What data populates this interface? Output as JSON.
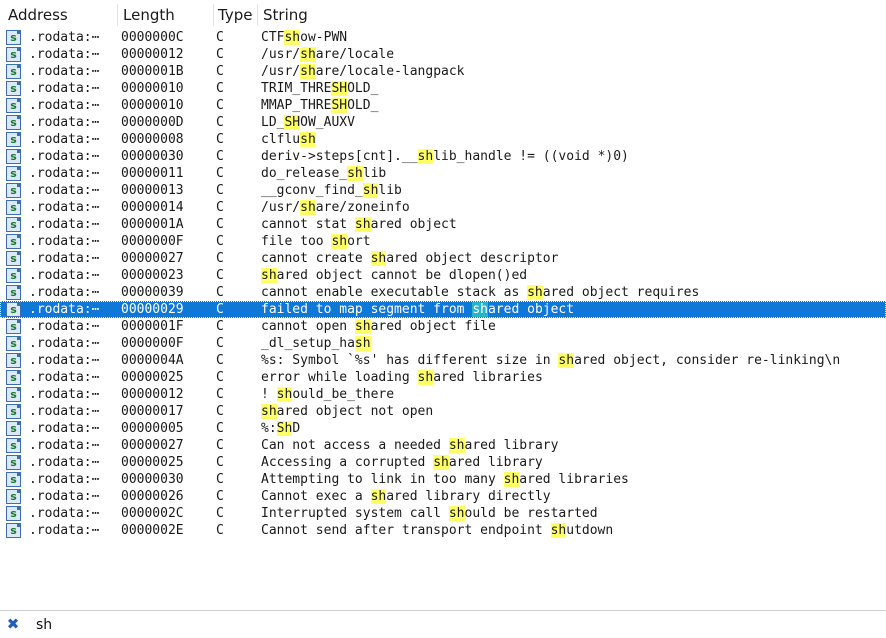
{
  "columns": {
    "address": "Address",
    "length": "Length",
    "type": "Type",
    "string": "String"
  },
  "highlight_color": "#ffff66",
  "selection_color": "#0f78d7",
  "row_icon": "string-s-icon",
  "selected_index": 16,
  "rows": [
    {
      "address": ".rodata:⋯",
      "length": "0000000C",
      "type": "C",
      "string": "CTFshow-PWN"
    },
    {
      "address": ".rodata:⋯",
      "length": "00000012",
      "type": "C",
      "string": "/usr/share/locale"
    },
    {
      "address": ".rodata:⋯",
      "length": "0000001B",
      "type": "C",
      "string": "/usr/share/locale-langpack"
    },
    {
      "address": ".rodata:⋯",
      "length": "00000010",
      "type": "C",
      "string": "TRIM_THRESHOLD_"
    },
    {
      "address": ".rodata:⋯",
      "length": "00000010",
      "type": "C",
      "string": "MMAP_THRESHOLD_"
    },
    {
      "address": ".rodata:⋯",
      "length": "0000000D",
      "type": "C",
      "string": "LD_SHOW_AUXV"
    },
    {
      "address": ".rodata:⋯",
      "length": "00000008",
      "type": "C",
      "string": "clflush"
    },
    {
      "address": ".rodata:⋯",
      "length": "00000030",
      "type": "C",
      "string": "deriv->steps[cnt].__shlib_handle != ((void *)0)"
    },
    {
      "address": ".rodata:⋯",
      "length": "00000011",
      "type": "C",
      "string": "do_release_shlib"
    },
    {
      "address": ".rodata:⋯",
      "length": "00000013",
      "type": "C",
      "string": "__gconv_find_shlib"
    },
    {
      "address": ".rodata:⋯",
      "length": "00000014",
      "type": "C",
      "string": "/usr/share/zoneinfo"
    },
    {
      "address": ".rodata:⋯",
      "length": "0000001A",
      "type": "C",
      "string": "cannot stat shared object"
    },
    {
      "address": ".rodata:⋯",
      "length": "0000000F",
      "type": "C",
      "string": "file too short"
    },
    {
      "address": ".rodata:⋯",
      "length": "00000027",
      "type": "C",
      "string": "cannot create shared object descriptor"
    },
    {
      "address": ".rodata:⋯",
      "length": "00000023",
      "type": "C",
      "string": "shared object cannot be dlopen()ed"
    },
    {
      "address": ".rodata:⋯",
      "length": "00000039",
      "type": "C",
      "string": "cannot enable executable stack as shared object requires"
    },
    {
      "address": ".rodata:⋯",
      "length": "00000029",
      "type": "C",
      "string": "failed to map segment from shared object"
    },
    {
      "address": ".rodata:⋯",
      "length": "0000001F",
      "type": "C",
      "string": "cannot open shared object file"
    },
    {
      "address": ".rodata:⋯",
      "length": "0000000F",
      "type": "C",
      "string": "_dl_setup_hash"
    },
    {
      "address": ".rodata:⋯",
      "length": "0000004A",
      "type": "C",
      "string": "%s: Symbol `%s' has different size in shared object, consider re-linking\\n"
    },
    {
      "address": ".rodata:⋯",
      "length": "00000025",
      "type": "C",
      "string": "error while loading shared libraries"
    },
    {
      "address": ".rodata:⋯",
      "length": "00000012",
      "type": "C",
      "string": "! should_be_there"
    },
    {
      "address": ".rodata:⋯",
      "length": "00000017",
      "type": "C",
      "string": "shared object not open"
    },
    {
      "address": ".rodata:⋯",
      "length": "00000005",
      "type": "C",
      "string": "%:ShD"
    },
    {
      "address": ".rodata:⋯",
      "length": "00000027",
      "type": "C",
      "string": "Can not access a needed shared library"
    },
    {
      "address": ".rodata:⋯",
      "length": "00000025",
      "type": "C",
      "string": "Accessing a corrupted shared library"
    },
    {
      "address": ".rodata:⋯",
      "length": "00000030",
      "type": "C",
      "string": "Attempting to link in too many shared libraries"
    },
    {
      "address": ".rodata:⋯",
      "length": "00000026",
      "type": "C",
      "string": "Cannot exec a shared library directly"
    },
    {
      "address": ".rodata:⋯",
      "length": "0000002C",
      "type": "C",
      "string": "Interrupted system call should be restarted"
    },
    {
      "address": ".rodata:⋯",
      "length": "0000002E",
      "type": "C",
      "string": "Cannot send after transport endpoint shutdown"
    }
  ],
  "search": {
    "icon": "close-icon",
    "text": "sh"
  }
}
